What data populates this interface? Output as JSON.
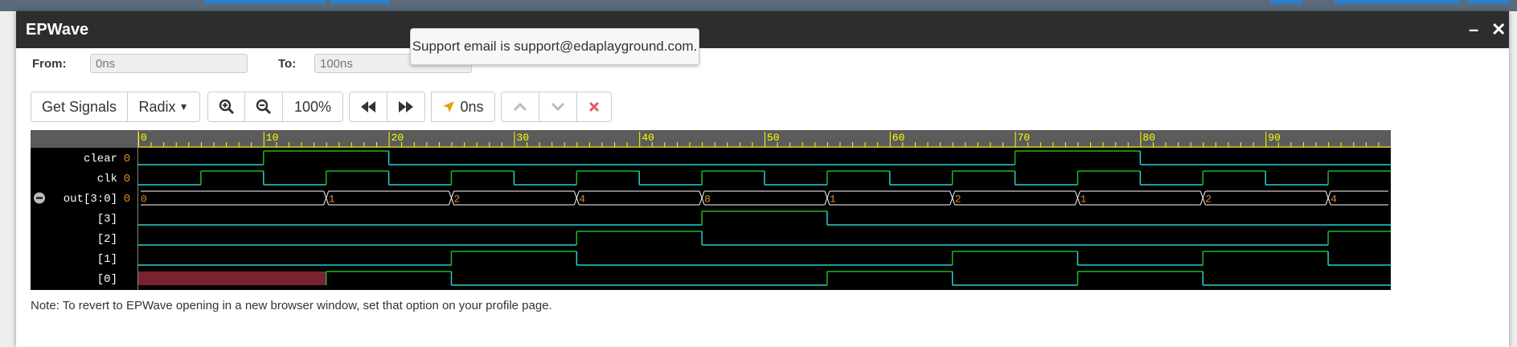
{
  "dialog": {
    "title": "EPWave",
    "minimize_icon": "minimize-icon",
    "close_icon": "close-icon"
  },
  "tooltip": {
    "text": "Support email is support@edaplayground.com."
  },
  "range": {
    "from_label": "From:",
    "from_value": "0ns",
    "to_label": "To:",
    "to_value": "100ns"
  },
  "toolbar": {
    "get_signals": "Get Signals",
    "radix": "Radix",
    "zoom": "100%",
    "cursor_time": "0ns",
    "icons": [
      "zoom-in-icon",
      "zoom-out-icon",
      "rewind-icon",
      "fast-forward-icon",
      "location-arrow-icon",
      "chevron-up-icon",
      "chevron-down-icon",
      "remove-icon"
    ]
  },
  "waveform": {
    "time_ticks": [
      "0",
      "10",
      "20",
      "30",
      "40",
      "50",
      "60",
      "70",
      "80",
      "90"
    ],
    "time_range": [
      0,
      100
    ],
    "signals": [
      {
        "name": "clear",
        "value": "0",
        "type": "bit",
        "transitions": [
          [
            0,
            0
          ],
          [
            10,
            1
          ],
          [
            20,
            0
          ],
          [
            70,
            1
          ],
          [
            80,
            0
          ]
        ]
      },
      {
        "name": "clk",
        "value": "0",
        "type": "bit",
        "transitions": [
          [
            0,
            0
          ],
          [
            5,
            1
          ],
          [
            10,
            0
          ],
          [
            15,
            1
          ],
          [
            20,
            0
          ],
          [
            25,
            1
          ],
          [
            30,
            0
          ],
          [
            35,
            1
          ],
          [
            40,
            0
          ],
          [
            45,
            1
          ],
          [
            50,
            0
          ],
          [
            55,
            1
          ],
          [
            60,
            0
          ],
          [
            65,
            1
          ],
          [
            70,
            0
          ],
          [
            75,
            1
          ],
          [
            80,
            0
          ],
          [
            85,
            1
          ],
          [
            90,
            0
          ],
          [
            95,
            1
          ]
        ]
      },
      {
        "name": "out[3:0]",
        "value": "0",
        "type": "bus",
        "collapse_icon": "collapse-icon",
        "segments": [
          [
            0,
            "0"
          ],
          [
            15,
            "1"
          ],
          [
            25,
            "2"
          ],
          [
            35,
            "4"
          ],
          [
            45,
            "8"
          ],
          [
            55,
            "1"
          ],
          [
            65,
            "2"
          ],
          [
            75,
            "1"
          ],
          [
            85,
            "2"
          ],
          [
            95,
            "4"
          ]
        ]
      },
      {
        "name": "[3]",
        "value": "",
        "type": "bit",
        "transitions": [
          [
            0,
            0
          ],
          [
            45,
            1
          ],
          [
            55,
            0
          ]
        ]
      },
      {
        "name": "[2]",
        "value": "",
        "type": "bit",
        "transitions": [
          [
            0,
            0
          ],
          [
            35,
            1
          ],
          [
            45,
            0
          ],
          [
            95,
            1
          ]
        ]
      },
      {
        "name": "[1]",
        "value": "",
        "type": "bit",
        "transitions": [
          [
            0,
            0
          ],
          [
            25,
            1
          ],
          [
            35,
            0
          ],
          [
            65,
            1
          ],
          [
            75,
            0
          ],
          [
            85,
            1
          ],
          [
            95,
            0
          ]
        ]
      },
      {
        "name": "[0]",
        "value": "",
        "type": "bit",
        "transitions": [
          [
            0,
            "x"
          ],
          [
            15,
            1
          ],
          [
            25,
            0
          ],
          [
            55,
            1
          ],
          [
            65,
            0
          ],
          [
            75,
            1
          ],
          [
            85,
            0
          ]
        ]
      }
    ],
    "colors": {
      "bg": "#000000",
      "ruler": "#5b5b5b",
      "tick": "#ffff00",
      "grid": "#ffffff",
      "high": "#1fb81f",
      "low": "#29d0d0",
      "value": "#e08a2a",
      "unknown": "#7a2230"
    }
  },
  "note": "Note: To revert to EPWave opening in a new browser window, set that option on your profile page."
}
